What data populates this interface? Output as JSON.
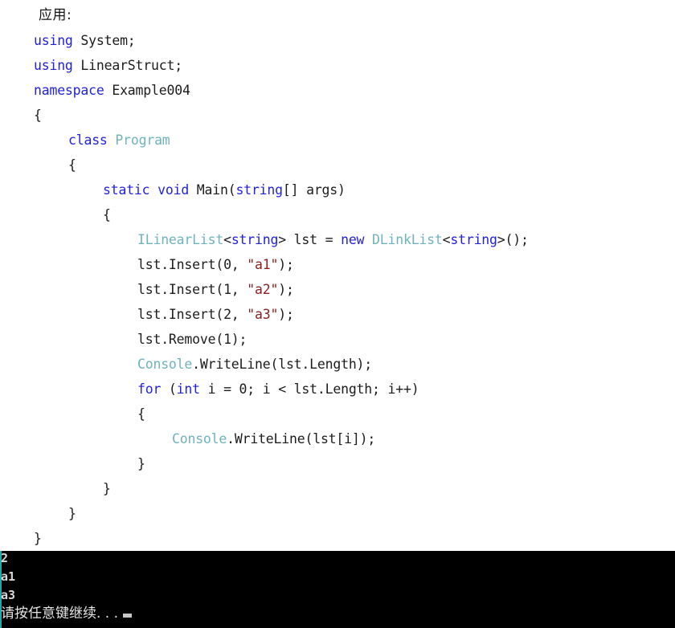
{
  "document": {
    "heading": "应用:",
    "language": "csharp"
  },
  "code": {
    "lines": [
      {
        "indent": 0,
        "tokens": [
          {
            "t": "kw",
            "v": "using"
          },
          {
            "t": "pln",
            "v": " System;"
          }
        ]
      },
      {
        "indent": 0,
        "tokens": [
          {
            "t": "kw",
            "v": "using"
          },
          {
            "t": "pln",
            "v": " LinearStruct;"
          }
        ]
      },
      {
        "indent": 0,
        "tokens": [
          {
            "t": "kw",
            "v": "namespace"
          },
          {
            "t": "pln",
            "v": " Example004"
          }
        ]
      },
      {
        "indent": 0,
        "tokens": [
          {
            "t": "pln",
            "v": "{"
          }
        ]
      },
      {
        "indent": 1,
        "tokens": [
          {
            "t": "kw",
            "v": "class"
          },
          {
            "t": "pln",
            "v": " "
          },
          {
            "t": "typ",
            "v": "Program"
          }
        ]
      },
      {
        "indent": 1,
        "tokens": [
          {
            "t": "pln",
            "v": "{"
          }
        ]
      },
      {
        "indent": 2,
        "tokens": [
          {
            "t": "kw",
            "v": "static void"
          },
          {
            "t": "pln",
            "v": " Main("
          },
          {
            "t": "kw",
            "v": "string"
          },
          {
            "t": "pln",
            "v": "[] args)"
          }
        ]
      },
      {
        "indent": 2,
        "tokens": [
          {
            "t": "pln",
            "v": "{"
          }
        ]
      },
      {
        "indent": 3,
        "tokens": [
          {
            "t": "typ",
            "v": "ILinearList"
          },
          {
            "t": "pln",
            "v": "<"
          },
          {
            "t": "kw",
            "v": "string"
          },
          {
            "t": "pln",
            "v": "> lst = "
          },
          {
            "t": "kw",
            "v": "new"
          },
          {
            "t": "pln",
            "v": " "
          },
          {
            "t": "typ",
            "v": "DLinkList"
          },
          {
            "t": "pln",
            "v": "<"
          },
          {
            "t": "kw",
            "v": "string"
          },
          {
            "t": "pln",
            "v": ">();"
          }
        ]
      },
      {
        "indent": 3,
        "tokens": [
          {
            "t": "pln",
            "v": "lst.Insert(0, "
          },
          {
            "t": "str",
            "v": "\"a1\""
          },
          {
            "t": "pln",
            "v": ");"
          }
        ]
      },
      {
        "indent": 3,
        "tokens": [
          {
            "t": "pln",
            "v": "lst.Insert(1, "
          },
          {
            "t": "str",
            "v": "\"a2\""
          },
          {
            "t": "pln",
            "v": ");"
          }
        ]
      },
      {
        "indent": 3,
        "tokens": [
          {
            "t": "pln",
            "v": "lst.Insert(2, "
          },
          {
            "t": "str",
            "v": "\"a3\""
          },
          {
            "t": "pln",
            "v": ");"
          }
        ]
      },
      {
        "indent": 3,
        "tokens": [
          {
            "t": "pln",
            "v": "lst.Remove(1);"
          }
        ]
      },
      {
        "indent": 3,
        "tokens": [
          {
            "t": "typ",
            "v": "Console"
          },
          {
            "t": "pln",
            "v": ".WriteLine(lst.Length);"
          }
        ]
      },
      {
        "indent": 3,
        "tokens": [
          {
            "t": "kw",
            "v": "for"
          },
          {
            "t": "pln",
            "v": " ("
          },
          {
            "t": "kw",
            "v": "int"
          },
          {
            "t": "pln",
            "v": " i = 0; i < lst.Length; i++)"
          }
        ]
      },
      {
        "indent": 3,
        "tokens": [
          {
            "t": "pln",
            "v": "{"
          }
        ]
      },
      {
        "indent": 4,
        "tokens": [
          {
            "t": "typ",
            "v": "Console"
          },
          {
            "t": "pln",
            "v": ".WriteLine(lst[i]);"
          }
        ]
      },
      {
        "indent": 3,
        "tokens": [
          {
            "t": "pln",
            "v": "}"
          }
        ]
      },
      {
        "indent": 2,
        "tokens": [
          {
            "t": "pln",
            "v": "}"
          }
        ]
      },
      {
        "indent": 1,
        "tokens": [
          {
            "t": "pln",
            "v": "}"
          }
        ]
      },
      {
        "indent": 0,
        "tokens": [
          {
            "t": "pln",
            "v": "}"
          }
        ]
      }
    ],
    "colors": {
      "keyword": "#2222dd",
      "type": "#6fb3bd",
      "string": "#8b2121",
      "plain": "#1c1c1c",
      "background": "#ffffff"
    }
  },
  "console": {
    "lines": [
      {
        "text": "2",
        "cn": false,
        "cursor": false
      },
      {
        "text": "a1",
        "cn": false,
        "cursor": false
      },
      {
        "text": "a3",
        "cn": false,
        "cursor": false
      },
      {
        "text": "请按任意键继续. . .",
        "cn": true,
        "cursor": true
      }
    ],
    "colors": {
      "background": "#000000",
      "text": "#d8d8d8",
      "left_edge": "#23a6a6",
      "cursor": "#c9c9c9"
    }
  }
}
